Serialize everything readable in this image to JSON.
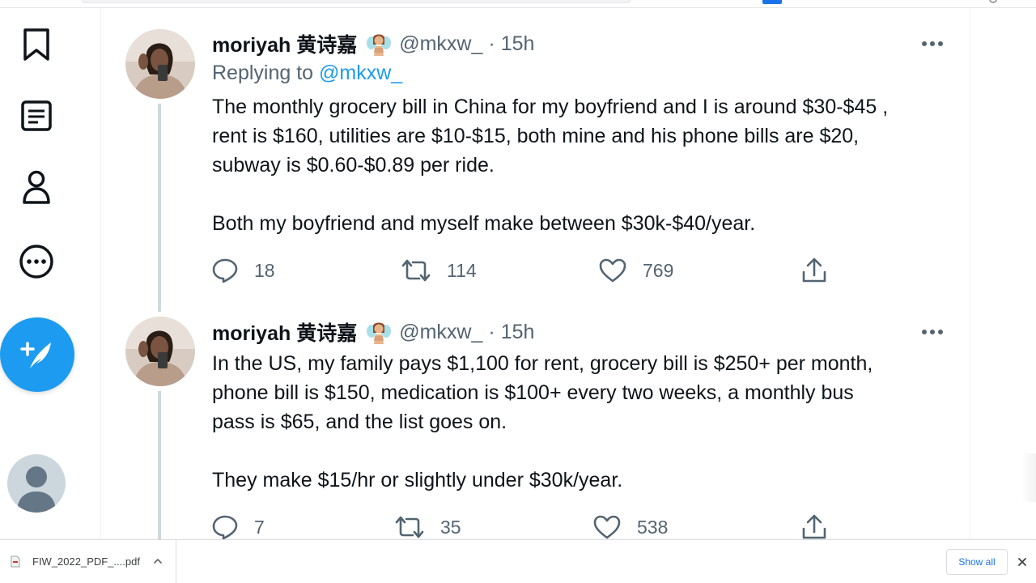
{
  "colors": {
    "accent": "#1d9bf0",
    "text_primary": "#0f1419",
    "text_secondary": "#536471",
    "thread_line": "#cfd9de"
  },
  "nav": {
    "items": [
      {
        "icon": "bookmark-icon"
      },
      {
        "icon": "lists-icon"
      },
      {
        "icon": "profile-icon"
      },
      {
        "icon": "more-icon"
      }
    ],
    "compose_icon": "compose-tweet-icon",
    "profile_avatar_icon": "default-avatar-icon"
  },
  "tweets": [
    {
      "name": "moriyah 黄诗嘉",
      "emoji_icon": "fairy-emoji-icon",
      "handle": "@mkxw_",
      "separator": "·",
      "time": "15h",
      "replying_prefix": "Replying to",
      "replying_mention": "@mkxw_",
      "body_lines": [
        "The monthly grocery bill in China for my boyfriend and I is around $30-$45 ,",
        "rent is $160, utilities are $10-$15, both mine and his phone bills are $20,",
        "subway is $0.60-$0.89 per ride."
      ],
      "body_lines_2": [
        "Both my boyfriend and myself make between $30k-$40/year."
      ],
      "replies": "18",
      "retweets": "114",
      "likes": "769"
    },
    {
      "name": "moriyah 黄诗嘉",
      "emoji_icon": "fairy-emoji-icon",
      "handle": "@mkxw_",
      "separator": "·",
      "time": "15h",
      "body_lines": [
        "In the US, my family pays $1,100 for rent, grocery bill is $250+ per month,",
        "phone bill is $150, medication is $100+ every two weeks, a monthly bus",
        "pass is $65, and the list goes on."
      ],
      "body_lines_2": [
        "They make $15/hr or slightly under $30k/year."
      ],
      "replies": "7",
      "retweets": "35",
      "likes": "538"
    }
  ],
  "download_bar": {
    "file_name": "FIW_2022_PDF_....pdf",
    "show_all_label": "Show all"
  }
}
